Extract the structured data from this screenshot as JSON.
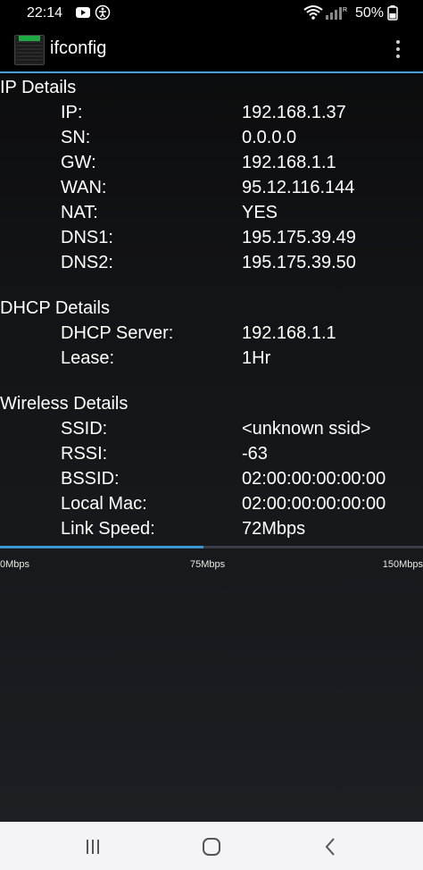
{
  "status_bar": {
    "time": "22:14",
    "battery": "50%",
    "icons": [
      "youtube-icon",
      "accessibility-icon",
      "wifi-icon",
      "signal-icon",
      "battery-icon"
    ]
  },
  "app_bar": {
    "title": "ifconfig",
    "icon": "app-terminal-icon",
    "menu_icon": "overflow-menu-icon"
  },
  "sections": {
    "ip": {
      "title": "IP Details",
      "rows": [
        {
          "label": "IP:",
          "value": "192.168.1.37"
        },
        {
          "label": "SN:",
          "value": "0.0.0.0"
        },
        {
          "label": "GW:",
          "value": "192.168.1.1"
        },
        {
          "label": "WAN:",
          "value": "95.12.116.144"
        },
        {
          "label": "NAT:",
          "value": "YES"
        },
        {
          "label": "DNS1:",
          "value": "195.175.39.49"
        },
        {
          "label": "DNS2:",
          "value": "195.175.39.50"
        }
      ]
    },
    "dhcp": {
      "title": "DHCP Details",
      "rows": [
        {
          "label": "DHCP Server:",
          "value": "192.168.1.1"
        },
        {
          "label": "Lease:",
          "value": "1Hr"
        }
      ]
    },
    "wireless": {
      "title": "Wireless Details",
      "rows": [
        {
          "label": "SSID:",
          "value": "<unknown ssid>"
        },
        {
          "label": "RSSI:",
          "value": "-63"
        },
        {
          "label": "BSSID:",
          "value": "02:00:00:00:00:00"
        },
        {
          "label": "Local Mac:",
          "value": "02:00:00:00:00:00"
        },
        {
          "label": "Link Speed:",
          "value": "72Mbps"
        }
      ]
    }
  },
  "speed_meter": {
    "fraction": 0.48,
    "ticks": [
      "0Mbps",
      "75Mbps",
      "150Mbps"
    ],
    "fill_color": "#3a97d2"
  },
  "nav_bar": {
    "icons": [
      "recent-apps-icon",
      "home-icon",
      "back-icon"
    ]
  },
  "colors": {
    "accent": "#4aa3d8"
  }
}
